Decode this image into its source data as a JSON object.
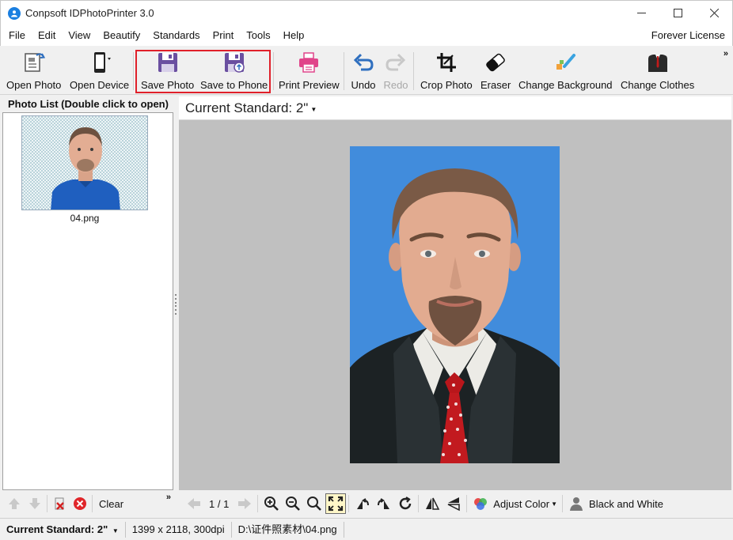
{
  "window": {
    "title": "Conpsoft IDPhotoPrinter 3.0"
  },
  "menu": {
    "items": [
      "File",
      "Edit",
      "View",
      "Beautify",
      "Standards",
      "Print",
      "Tools",
      "Help"
    ],
    "license": "Forever License"
  },
  "toolbar": {
    "open_photo": "Open Photo",
    "open_device": "Open Device",
    "save_photo": "Save Photo",
    "save_to_phone": "Save to Phone",
    "print_preview": "Print Preview",
    "undo": "Undo",
    "redo": "Redo",
    "crop_photo": "Crop Photo",
    "eraser": "Eraser",
    "change_background": "Change Background",
    "change_clothes": "Change Clothes",
    "more": "»"
  },
  "photo_list": {
    "title": "Photo List (Double click to open)",
    "items": [
      {
        "name": "04.png"
      }
    ],
    "clear_label": "Clear",
    "more": "»"
  },
  "main": {
    "standard_label": "Current Standard: 2\"",
    "page_indicator": "1 / 1",
    "adjust_color": "Adjust Color",
    "black_and_white": "Black and White",
    "photo_background": "#418cdc"
  },
  "status": {
    "standard": "Current Standard: 2\"",
    "dimensions": "1399 x 2118, 300dpi",
    "path": "D:\\证件照素材\\04.png"
  },
  "colors": {
    "save_highlight": "#e0202a",
    "undo_blue": "#2f6fbf",
    "save_purple": "#6a4fa0",
    "print_pink": "#e0448a"
  }
}
